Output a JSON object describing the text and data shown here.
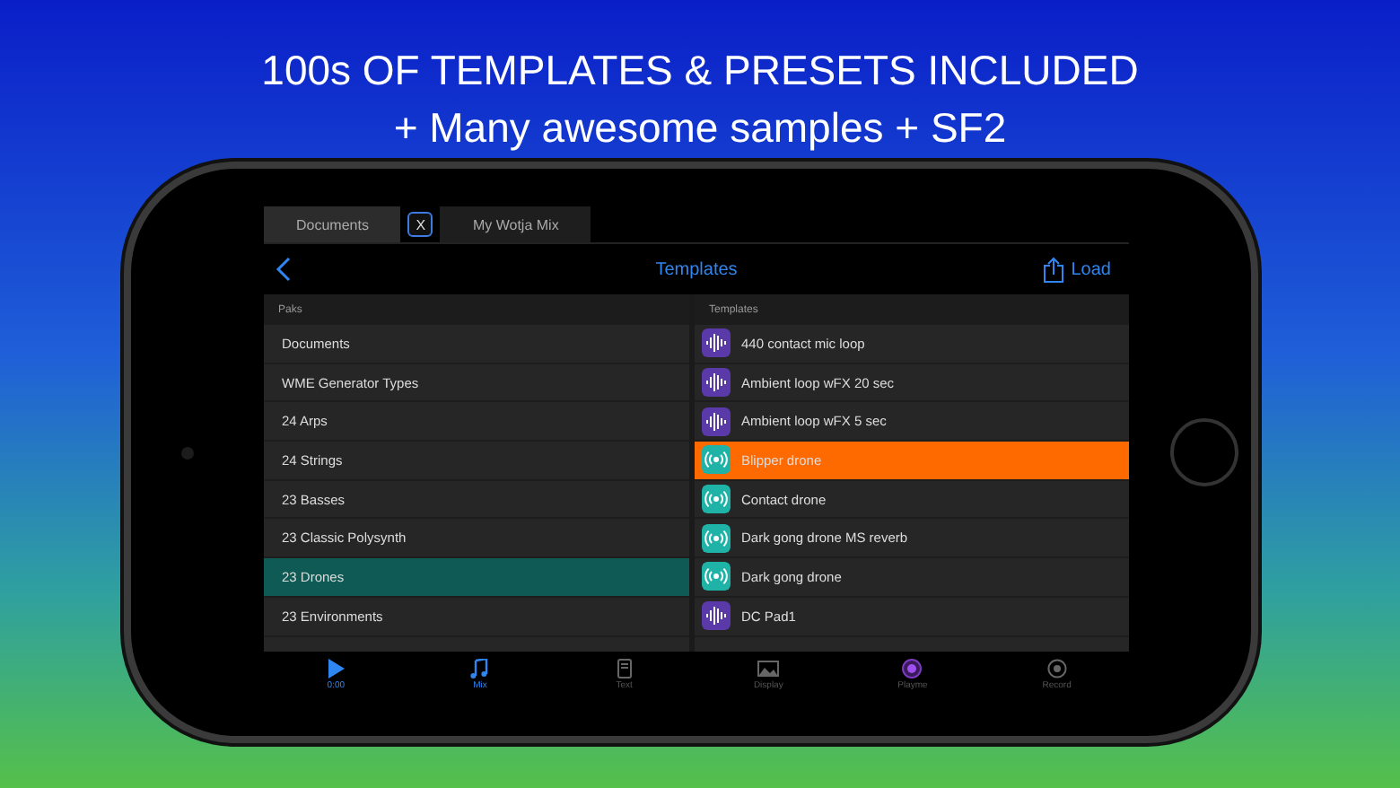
{
  "headline": [
    "100s OF TEMPLATES & PRESETS INCLUDED",
    "+ Many awesome samples + SF2"
  ],
  "doc_tabs": [
    {
      "label": "Documents",
      "selected": true
    },
    {
      "label": "My Wotja Mix",
      "selected": false
    }
  ],
  "close_label": "X",
  "nav": {
    "title": "Templates",
    "action": "Load"
  },
  "paks": {
    "header": "Paks",
    "items": [
      {
        "label": "Documents",
        "selected": false
      },
      {
        "label": "WME Generator Types",
        "selected": false
      },
      {
        "label": "24 Arps",
        "selected": false
      },
      {
        "label": "24 Strings",
        "selected": false
      },
      {
        "label": "23 Basses",
        "selected": false
      },
      {
        "label": "23 Classic Polysynth",
        "selected": false
      },
      {
        "label": "23 Drones",
        "selected": true
      },
      {
        "label": "23 Environments",
        "selected": false
      }
    ]
  },
  "templates": {
    "header": "Templates",
    "items": [
      {
        "label": "440 contact mic loop",
        "kind": "wave",
        "selected": false
      },
      {
        "label": "Ambient loop wFX 20 sec",
        "kind": "wave",
        "selected": false
      },
      {
        "label": "Ambient loop wFX 5 sec",
        "kind": "wave",
        "selected": false
      },
      {
        "label": "Blipper drone",
        "kind": "radio",
        "selected": true
      },
      {
        "label": "Contact drone",
        "kind": "radio",
        "selected": false
      },
      {
        "label": "Dark gong drone MS reverb",
        "kind": "radio",
        "selected": false
      },
      {
        "label": "Dark gong drone",
        "kind": "radio",
        "selected": false
      },
      {
        "label": "DC Pad1",
        "kind": "wave",
        "selected": false
      }
    ]
  },
  "tab_bar": [
    {
      "label": "0:00",
      "kind": "play",
      "selected": true
    },
    {
      "label": "Mix",
      "kind": "note",
      "selected": true
    },
    {
      "label": "Text",
      "kind": "doc",
      "selected": false
    },
    {
      "label": "Display",
      "kind": "image",
      "selected": false
    },
    {
      "label": "Playme",
      "kind": "orb",
      "selected": false
    },
    {
      "label": "Record",
      "kind": "record",
      "selected": false
    }
  ]
}
